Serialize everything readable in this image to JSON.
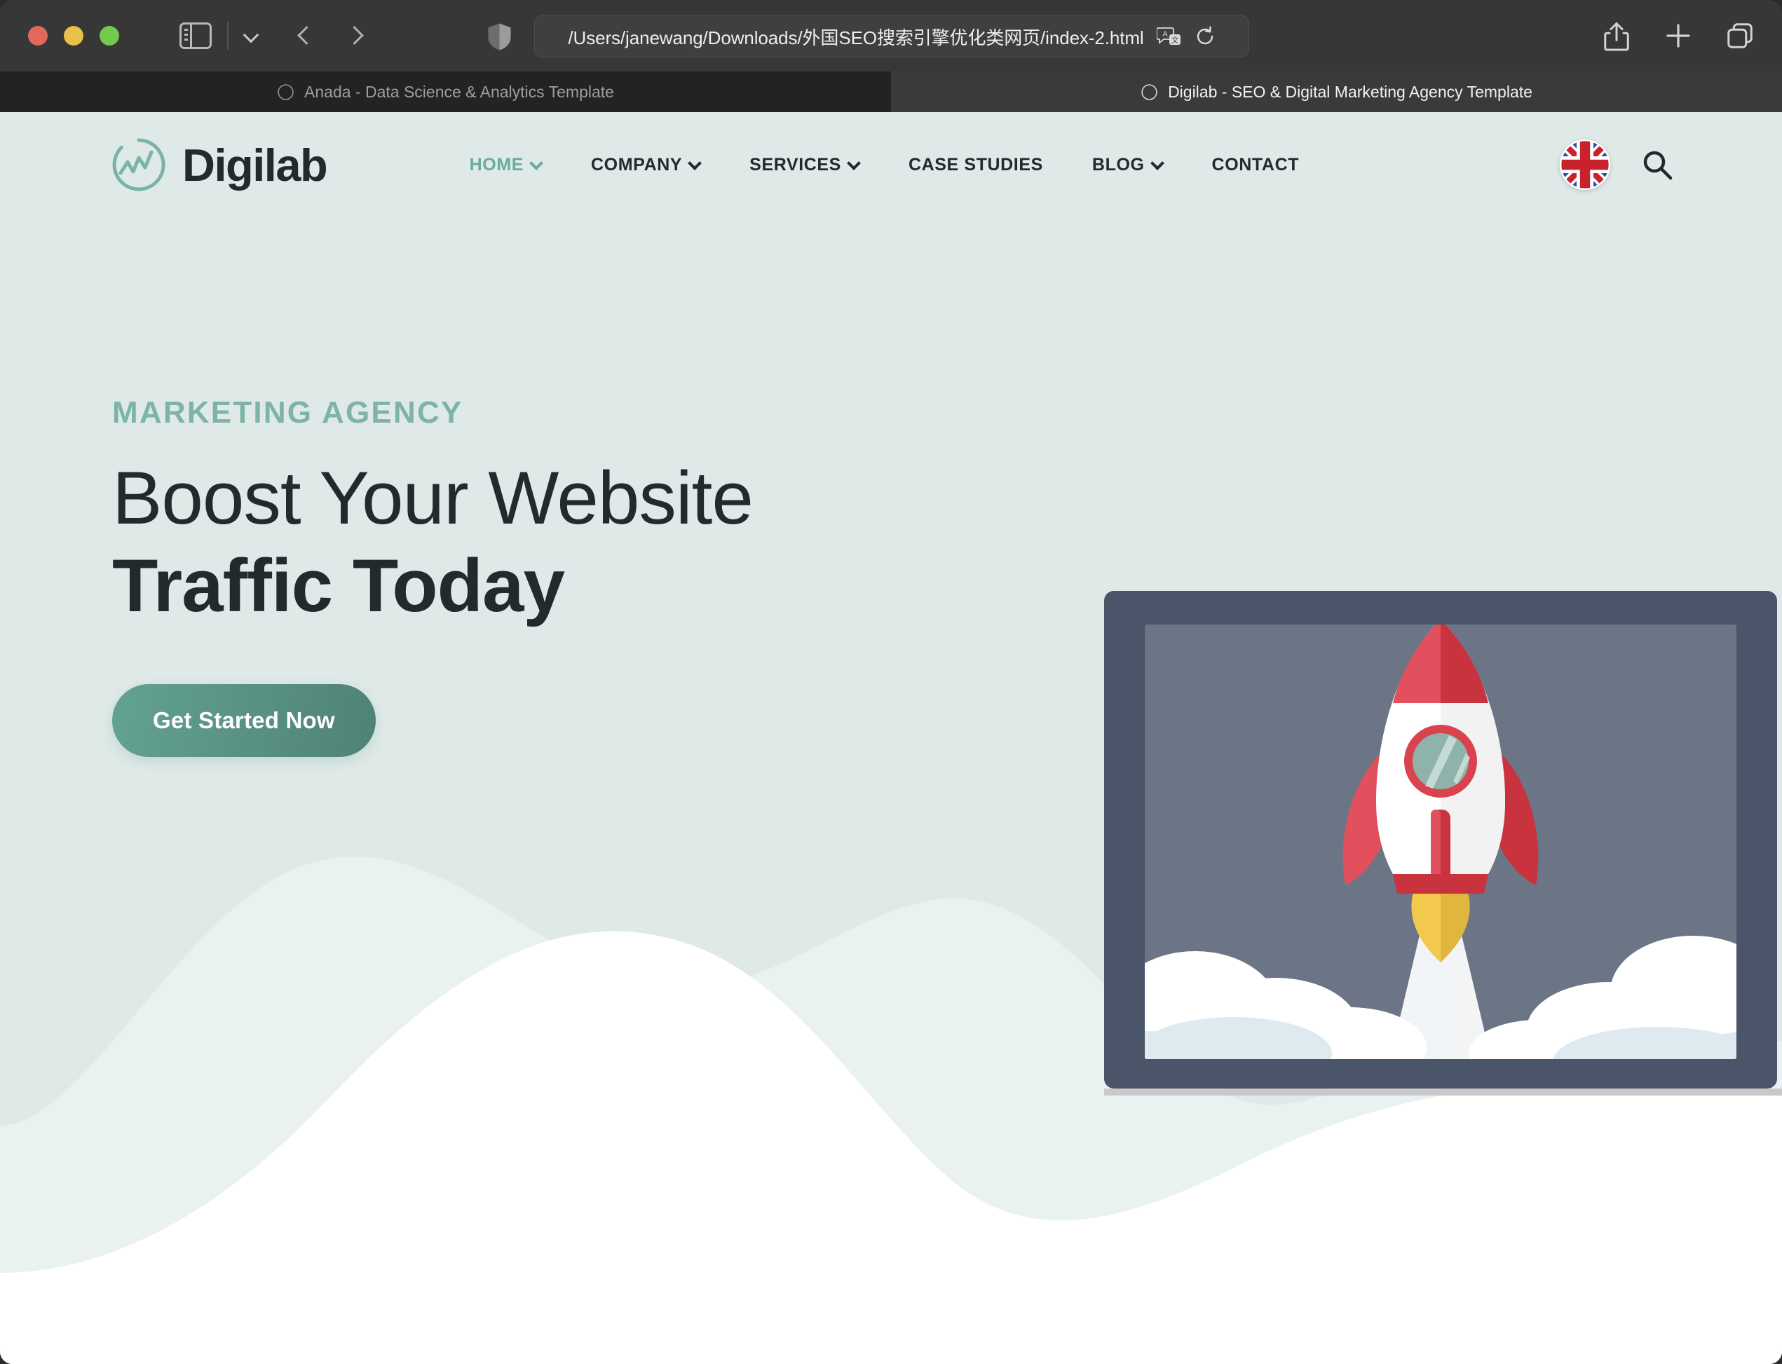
{
  "browser": {
    "url": "/Users/janewang/Downloads/外国SEO搜索引擎优化类网页/index-2.html",
    "toolbar_icons": {
      "sidebar": "sidebar-toggle-icon",
      "chevron": "chevron-down-icon",
      "back": "back-arrow-icon",
      "forward": "forward-arrow-icon",
      "shield": "shield-privacy-icon",
      "translate": "translate-icon",
      "reload": "reload-icon",
      "share": "share-icon",
      "new_tab": "plus-icon",
      "tab_overview": "tab-overview-icon"
    },
    "tabs": [
      {
        "title": "Anada - Data Science & Analytics Template",
        "active": false
      },
      {
        "title": "Digilab - SEO & Digital Marketing Agency Template",
        "active": true
      }
    ]
  },
  "site": {
    "logo_text": "Digilab",
    "nav": [
      {
        "label": "HOME",
        "has_caret": true,
        "active": true
      },
      {
        "label": "COMPANY",
        "has_caret": true,
        "active": false
      },
      {
        "label": "SERVICES",
        "has_caret": true,
        "active": false
      },
      {
        "label": "CASE STUDIES",
        "has_caret": false,
        "active": false
      },
      {
        "label": "BLOG",
        "has_caret": true,
        "active": false
      },
      {
        "label": "CONTACT",
        "has_caret": false,
        "active": false
      }
    ],
    "language_flag": "united-kingdom-flag",
    "search_icon": "search-icon"
  },
  "hero": {
    "eyebrow": "MARKETING AGENCY",
    "title_line1": "Boost Your Website",
    "title_line2": "Traffic Today",
    "cta_label": "Get Started Now",
    "illustration": "rocket-launch-on-laptop"
  },
  "colors": {
    "page_background": "#dfeae8",
    "accent_teal": "#6aab9c",
    "eyebrow_teal": "#7eb4a5",
    "heading_dark": "#242a2c",
    "cta_gradient_from": "#63a292",
    "cta_gradient_to": "#4f8274",
    "laptop_frame": "#4a5569",
    "laptop_screen": "#6b7585",
    "laptop_base": "#c9c9c9",
    "rocket_red": "#cf3b45",
    "rocket_red_light": "#e1505c",
    "rocket_white": "#ffffff",
    "rocket_flame": "#f2c94c",
    "porthole_glass": "#8fb3ab",
    "wave_light": "#e9f2f0",
    "wave_white": "#ffffff"
  }
}
